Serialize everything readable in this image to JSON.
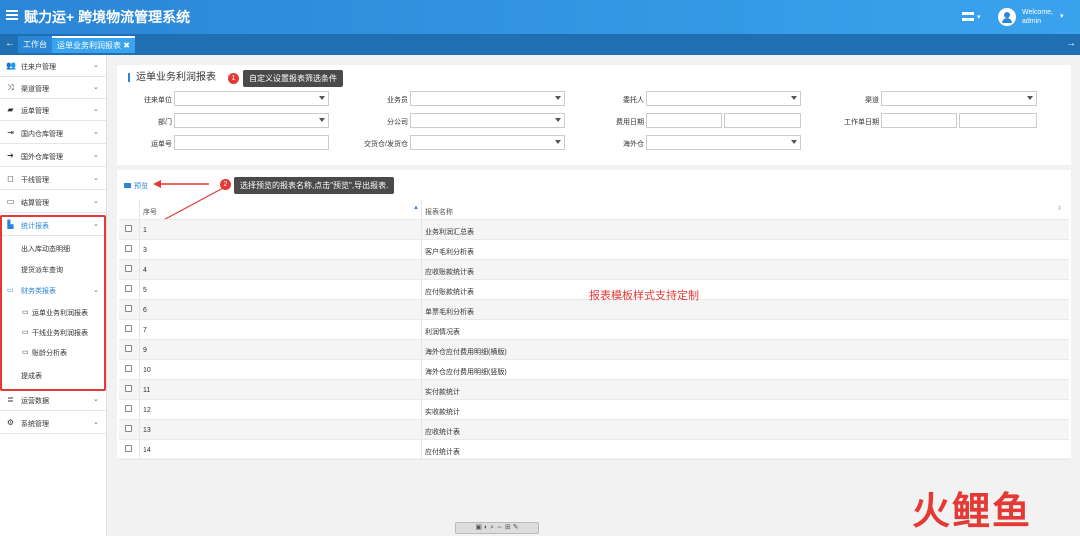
{
  "app": {
    "title": "赋力运+ 跨境物流管理系统",
    "welcome": "Welcome,",
    "user": "admin"
  },
  "tabs": [
    {
      "label": "工作台"
    },
    {
      "label": "运单业务利润报表 ✖"
    }
  ],
  "sidebar": {
    "items": [
      {
        "label": "往来户管理",
        "icon": "users-icon"
      },
      {
        "label": "渠道管理",
        "icon": "shuffle-icon"
      },
      {
        "label": "运单管理",
        "icon": "truck-icon"
      },
      {
        "label": "国内仓库管理",
        "icon": "sign-in-icon"
      },
      {
        "label": "国外仓库管理",
        "icon": "sign-out-icon"
      },
      {
        "label": "干线管理",
        "icon": "bookmark-icon"
      },
      {
        "label": "结算管理",
        "icon": "card-icon"
      },
      {
        "label": "统计报表",
        "icon": "bar-chart-icon"
      }
    ],
    "stats_sub": [
      {
        "label": "出入库动态明细"
      },
      {
        "label": "提货派车查询"
      }
    ],
    "finance": {
      "label": "财务类报表"
    },
    "finance_sub": [
      {
        "label": "运单业务利润报表"
      },
      {
        "label": "干线业务利润报表"
      },
      {
        "label": "账龄分析表"
      }
    ],
    "commission": {
      "label": "提成表"
    },
    "bottom_items": [
      {
        "label": "运营数据",
        "icon": "database-icon"
      },
      {
        "label": "系统管理",
        "icon": "gear-icon"
      }
    ]
  },
  "filter": {
    "title": "运单业务利润报表",
    "callout1": "自定义设置报表筛选条件",
    "badge1": "1",
    "labels": {
      "client": "往来单位",
      "salesman": "业务员",
      "consignor": "委托人",
      "channel": "渠道",
      "dept": "部门",
      "branch": "分公司",
      "fee_date": "费用日期",
      "job_date": "工作单日期",
      "waybill": "运单号",
      "warehouse": "交货仓/发货仓",
      "overseas": "海外仓"
    }
  },
  "list": {
    "preview_label": "预览",
    "callout2": "选择预览的报表名称,点击\"预览\",导出报表.",
    "badge2": "2",
    "col_no": "序号",
    "col_name": "报表名称",
    "rows": [
      {
        "no": "1",
        "name": "业务利润汇总表"
      },
      {
        "no": "3",
        "name": "客户毛利分析表"
      },
      {
        "no": "4",
        "name": "应收账款统计表"
      },
      {
        "no": "5",
        "name": "应付账款统计表"
      },
      {
        "no": "6",
        "name": "单票毛利分析表"
      },
      {
        "no": "7",
        "name": "利润情况表"
      },
      {
        "no": "9",
        "name": "海外仓应付费用明细(横版)"
      },
      {
        "no": "10",
        "name": "海外仓应付费用明细(竖版)"
      },
      {
        "no": "11",
        "name": "实付款统计"
      },
      {
        "no": "12",
        "name": "实收款统计"
      },
      {
        "no": "13",
        "name": "应收统计表"
      },
      {
        "no": "14",
        "name": "应付统计表"
      }
    ]
  },
  "note": "报表模板样式支持定制",
  "watermark": "火鲤鱼",
  "colors": {
    "accent": "#2a86d6",
    "red": "#e53935",
    "callout": "#4a4a4a"
  }
}
